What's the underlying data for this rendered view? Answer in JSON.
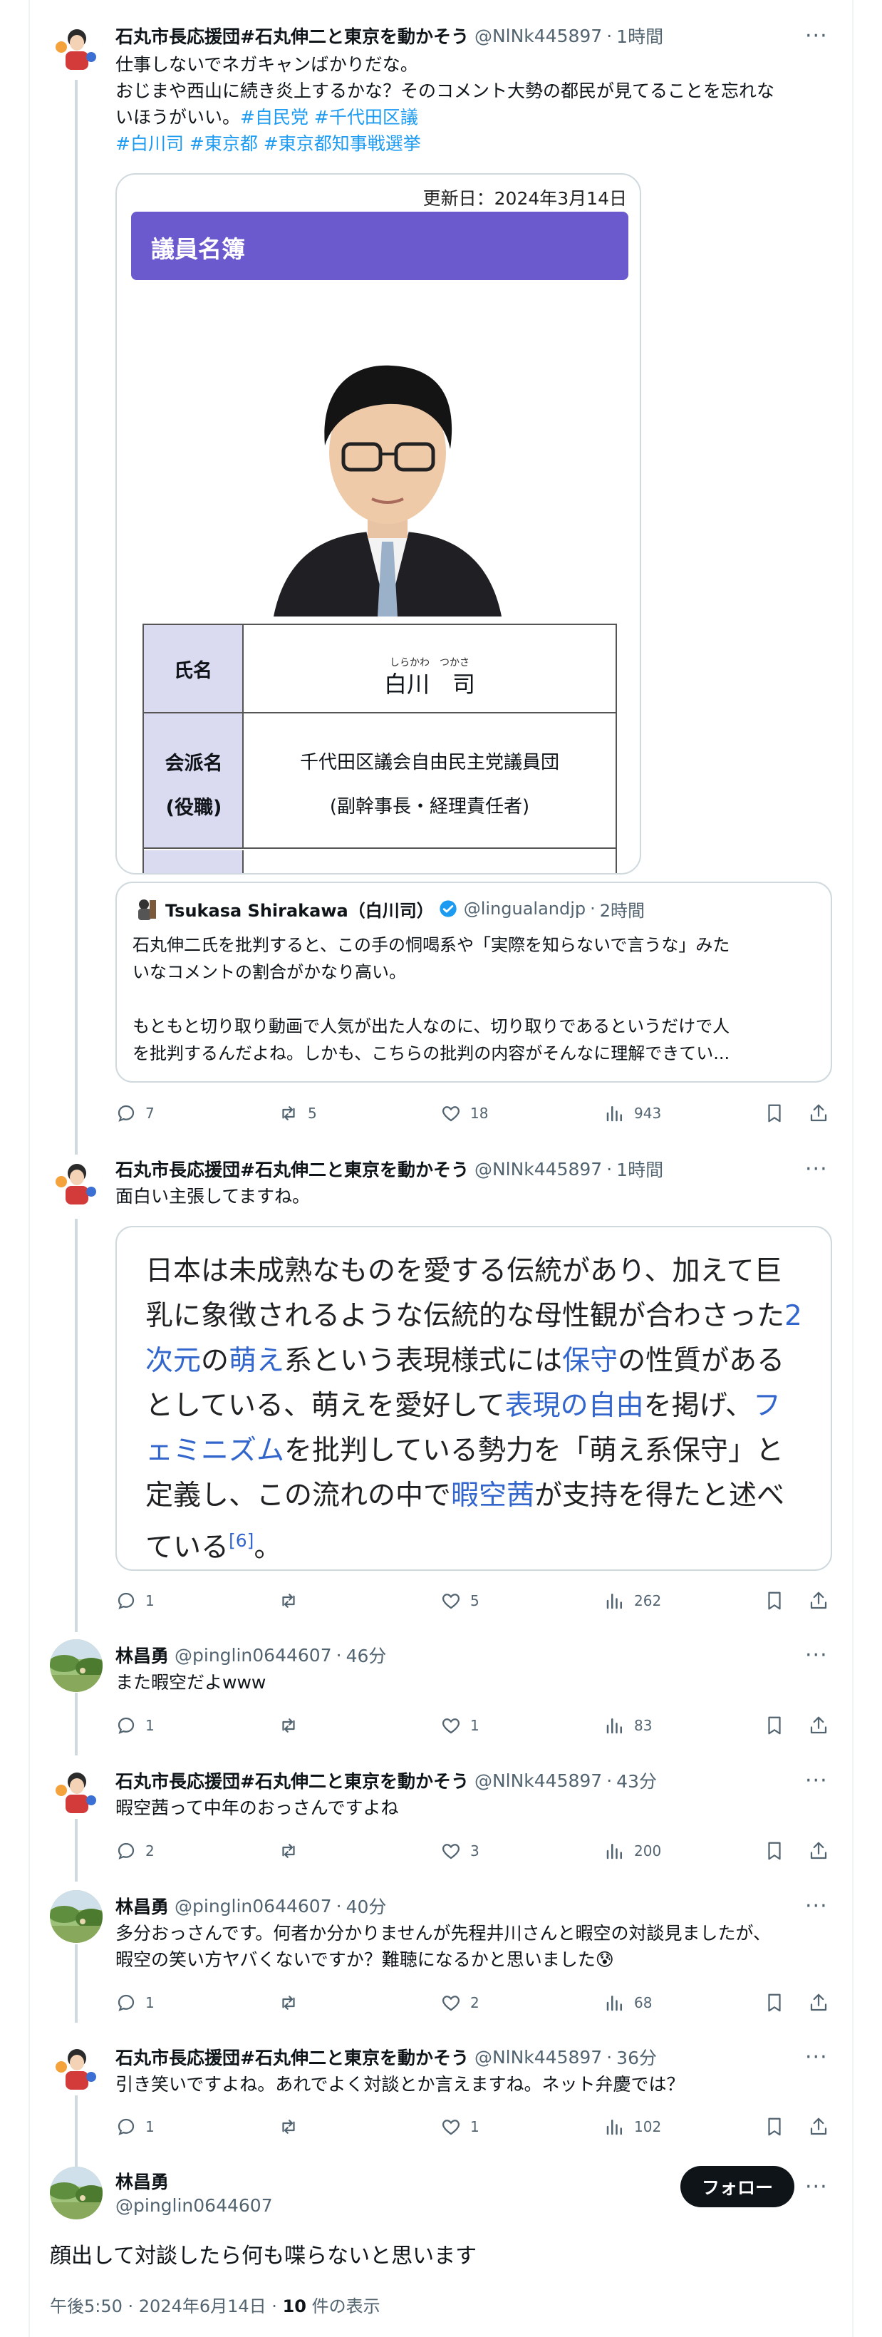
{
  "posts": [
    {
      "name": "石丸市長応援団#石丸伸二と東京を動かそう",
      "handle": "@NlNk445897",
      "time": "1時間",
      "text": "仕事しないでネガキャンばかりだな。",
      "text2": "おじまや西山に続き炎上するかな？そのコメント大勢の都民が見てることを忘れな",
      "text3a": "いほうがいい。",
      "tags3": "#自民党 #千代田区議",
      "tags4": "#白川司 #東京都 #東京都知事戦選挙",
      "replies": "7",
      "retweets": "5",
      "likes": "18",
      "views": "943"
    },
    {
      "name": "石丸市長応援団#石丸伸二と東京を動かそう",
      "handle": "@NlNk445897",
      "time": "1時間",
      "text": "面白い主張してますね。",
      "replies": "1",
      "retweets": "",
      "likes": "5",
      "views": "262"
    },
    {
      "name": "林昌勇",
      "handle": "@pinglin0644607",
      "time": "46分",
      "text": "また暇空だよwww",
      "replies": "1",
      "retweets": "",
      "likes": "1",
      "views": "83"
    },
    {
      "name": "石丸市長応援団#石丸伸二と東京を動かそう",
      "handle": "@NlNk445897",
      "time": "43分",
      "text": "暇空茜って中年のおっさんですよね",
      "replies": "2",
      "retweets": "",
      "likes": "3",
      "views": "200"
    },
    {
      "name": "林昌勇",
      "handle": "@pinglin0644607",
      "time": "40分",
      "text": "多分おっさんです。何者か分かりませんが先程井川さんと暇空の対談見ましたが、",
      "text2": "暇空の笑い方ヤバくないですか？難聴になるかと思いました😰",
      "replies": "1",
      "retweets": "",
      "likes": "2",
      "views": "68"
    },
    {
      "name": "石丸市長応援団#石丸伸二と東京を動かそう",
      "handle": "@NlNk445897",
      "time": "36分",
      "text": "引き笑いですよね。あれでよく対談とか言えますね。ネット弁慶では？",
      "replies": "1",
      "retweets": "",
      "likes": "1",
      "views": "102"
    }
  ],
  "profile_card": {
    "updated": "更新日：2024年3月14日",
    "title": "議員名簿",
    "row1_label": "氏名",
    "name_ruby": "しらかわ　つかさ",
    "name": "白川　司",
    "row2_label1": "会派名",
    "row2_label2": "(役職)",
    "faction": "千代田区議会自由民主党議員団",
    "role": "(副幹事長・経理責任者)"
  },
  "quote": {
    "name": "Tsukasa Shirakawa（白川司）",
    "handle": "@lingualandjp",
    "time": "2時間",
    "line1": "石丸伸二氏を批判すると、この手の恫喝系や「実際を知らないで言うな」みた",
    "line2": "いなコメントの割合がかなり高い。",
    "line3": "もともと切り取り動画で人気が出た人なのに、切り取りであるというだけで人",
    "line4": "を批判するんだよね。しかも、こちらの批判の内容がそんなに理解できてい..."
  },
  "wiki": {
    "l1": "日本は未成熟なものを愛する伝統があり、加えて巨",
    "l2a": "乳に象徴されるような伝統的な母性観が合わさった",
    "l2b": "2",
    "l3a": "次元",
    "l3b": "の",
    "l3c": "萌え",
    "l3d": "系という表現様式には",
    "l3e": "保守",
    "l3f": "の性質がある",
    "l4a": "としている、萌えを愛好して",
    "l4b": "表現の自由",
    "l4c": "を掲げ、",
    "l4d": "フ",
    "l5a": "ェミニズム",
    "l5b": "を批判している勢力を「萌え系保守」と",
    "l6a": "定義し、この流れの中で",
    "l6b": "暇空茜",
    "l6c": "が支持を得たと述べ",
    "l7a": "ている",
    "l7b": "[6]",
    "l7c": "。"
  },
  "main": {
    "name": "林昌勇",
    "handle": "@pinglin0644607",
    "follow": "フォロー",
    "text": "顔出して対談したら何も喋らないと思います",
    "meta_time": "午後5:50 · 2024年6月14日 · ",
    "meta_views": "10",
    "meta_suffix": " 件の表示"
  },
  "colors": {
    "link": "#1d9bf0",
    "wiki_link": "#3366cc",
    "purple_header": "#6a5acd",
    "text": "#0f1419",
    "muted": "#536471"
  }
}
